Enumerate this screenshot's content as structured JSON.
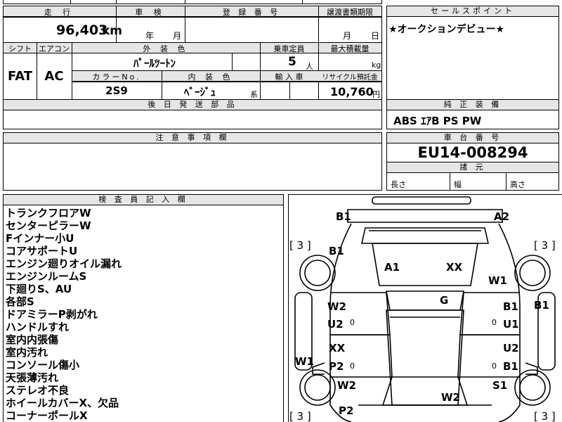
{
  "top_strip": {
    "partial_text": "...",
    "partial_text2": "..."
  },
  "mileage": {
    "header": "走 行",
    "value": "96,403",
    "unit": "km"
  },
  "inspection": {
    "header": "車 検",
    "year_label": "年",
    "month_label": "月",
    "value": ""
  },
  "registration": {
    "header": "登 録 番 号",
    "value": ""
  },
  "transfer_docs": {
    "header": "譲渡書類期限",
    "month_label": "月",
    "day_label": "日"
  },
  "sales_point": {
    "header": "セールスポイント",
    "text": "★オークションデビュー★"
  },
  "shift": {
    "header": "シフト",
    "value": "FAT"
  },
  "aircon": {
    "header": "エアコン",
    "value": "AC"
  },
  "exterior_color": {
    "header": "外 装 色",
    "value": "ﾊﾟｰﾙﾂｰﾄﾝ"
  },
  "capacity": {
    "header": "乗車定員",
    "value": "5",
    "unit": "人"
  },
  "max_load": {
    "header": "最大積載量",
    "unit": "kg",
    "value": ""
  },
  "color_no": {
    "header": "カラーNo.",
    "value": "2S9"
  },
  "interior_color": {
    "header": "内 装 色",
    "value": "ﾍﾞｰｼﾞｭ",
    "suffix": "系"
  },
  "import": {
    "header": "輸 入 車",
    "value": ""
  },
  "recycle": {
    "header": "リサイクル預託金",
    "value": "10,760",
    "unit": "円"
  },
  "later_parts": {
    "header": "後 日 発 送 部 品",
    "value": ""
  },
  "standard_equipment": {
    "header": "純 正 装 備",
    "value": "ABS ｴｱB PS PW"
  },
  "notes": {
    "header": "注 意 事 項 欄",
    "value": ""
  },
  "chassis": {
    "header": "車 台 番 号",
    "value": "EU14-008294"
  },
  "dimensions": {
    "header": "諸 元",
    "length_label": "長さ",
    "width_label": "幅",
    "height_label": "高さ"
  },
  "inspector": {
    "header": "検 査 員 記 入 欄",
    "lines": [
      "トランクフロアW",
      "センターピラーW",
      "Fインナー小U",
      "コアサポートU",
      "エンジン廻りオイル漏れ",
      "エンジンルームS",
      "下廻りS、AU",
      "各部S",
      "ドアミラーP剥がれ",
      "ハンドルすれ",
      "室内内張傷",
      "室内汚れ",
      "コンソール傷小",
      "天張薄汚れ",
      "ステレオ不良",
      "ホイールカバーX、欠品",
      "コーナーポールX"
    ]
  },
  "diagram": {
    "tire_marks": [
      "[ 3 ]",
      "[ 3 ]",
      "[ 3 ]",
      "[ 3 ]"
    ],
    "labels": {
      "rear_left": "B1",
      "rear_right": "A2",
      "left_rear_fender": "B1",
      "trunk_a": "A1",
      "trunk_b": "XX",
      "right_rear_fender": "W1",
      "right_rear_side": "B1",
      "roof": "G",
      "left_rear_door_1": "W2",
      "left_rear_door_2": "U2",
      "right_rear_door_1": "B1",
      "right_rear_door_2": "U1",
      "left_front_door_1": "XX",
      "left_front_door_2": "P2",
      "right_front_door_1": "U2",
      "right_front_door_2": "B1",
      "left_sill": "W1",
      "left_front_fender": "W2",
      "right_front_fender": "S1",
      "left_front_bumper": "P2",
      "hood": "W2",
      "zero_marks": [
        "0",
        "0",
        "0",
        "0"
      ]
    }
  }
}
